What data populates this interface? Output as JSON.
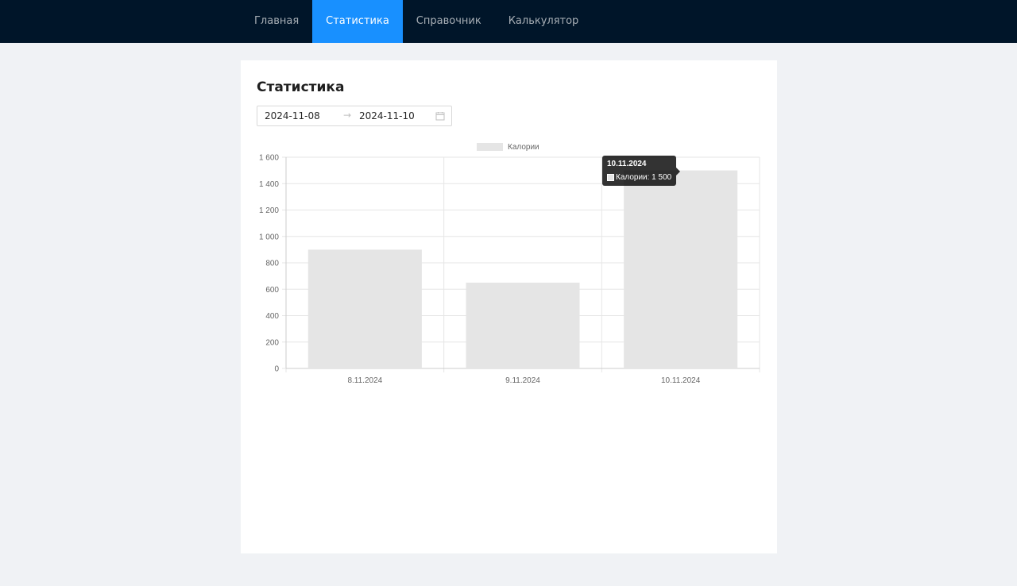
{
  "nav": {
    "items": [
      {
        "label": "Главная",
        "active": false
      },
      {
        "label": "Статистика",
        "active": true
      },
      {
        "label": "Справочник",
        "active": false
      },
      {
        "label": "Калькулятор",
        "active": false
      }
    ]
  },
  "page": {
    "title": "Статистика"
  },
  "date_range": {
    "start": "2024-11-08",
    "separator": "→",
    "end": "2024-11-10",
    "icon": "calendar-icon"
  },
  "tooltip": {
    "title": "10.11.2024",
    "label": "Калории: 1 500"
  },
  "colors": {
    "nav_bg": "#001529",
    "nav_active": "#1890ff",
    "bar_fill": "#e5e5e5",
    "page_bg": "#f0f2f5"
  },
  "chart_data": {
    "type": "bar",
    "categories": [
      "8.11.2024",
      "9.11.2024",
      "10.11.2024"
    ],
    "series": [
      {
        "name": "Калории",
        "values": [
          900,
          650,
          1500
        ]
      }
    ],
    "ylim": [
      0,
      1600
    ],
    "yticks": [
      0,
      200,
      400,
      600,
      800,
      1000,
      1200,
      1400,
      1600
    ],
    "ytick_labels": [
      "0",
      "200",
      "400",
      "600",
      "800",
      "1 000",
      "1 200",
      "1 400",
      "1 600"
    ],
    "legend": "top-center",
    "grid": true
  }
}
